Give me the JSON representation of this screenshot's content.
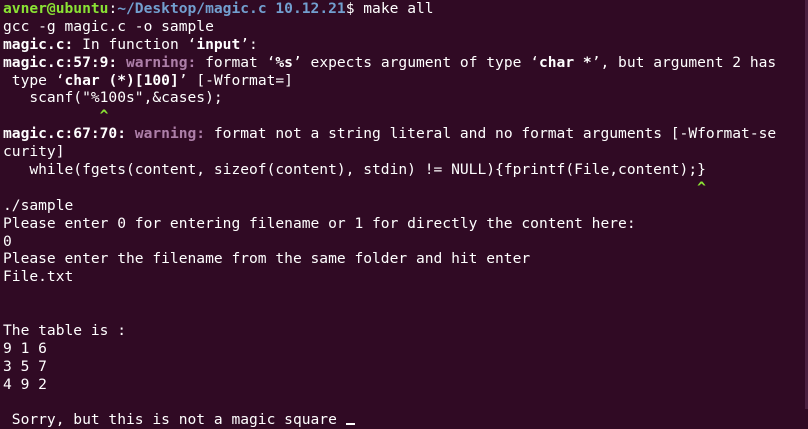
{
  "prompt": {
    "user": "avner@ubuntu",
    "sep": ":",
    "path": "~/Desktop/magic.c 10.12.21",
    "symbol": "$ ",
    "command": "make all"
  },
  "lines": {
    "l2": "gcc -g magic.c -o sample",
    "l3_file": "magic.c:",
    "l3_text": " In function ‘",
    "l3_func": "input",
    "l3_end": "’:",
    "l4_loc": "magic.c:57:9:",
    "l4_warn": " warning:",
    "l4_text1": " format ‘",
    "l4_fmt": "%s",
    "l4_text2": "’ expects argument of type ‘",
    "l4_type": "char *",
    "l4_text3": "’, but argument 2 has",
    "l5_text1": " type ‘",
    "l5_type": "char (*)[100]",
    "l5_text2": "’ [-Wformat=]",
    "l6": "   scanf(\"%100s\",&cases);",
    "l7_caret": "           ^",
    "l8_loc": "magic.c:67:70:",
    "l8_warn": " warning:",
    "l8_text": " format not a string literal and no format arguments [-Wformat-se",
    "l9": "curity]",
    "l10": "   while(fgets(content, sizeof(content), stdin) != NULL){fprintf(File,content);}",
    "l11_caret": "                                                                               ^",
    "l12": "./sample",
    "l13": "Please enter 0 for entering filename or 1 for directly the content here:",
    "l14": "0",
    "l15": "Please enter the filename from the same folder and hit enter",
    "l16": "File.txt",
    "l17": "",
    "l18": "",
    "l19": "The table is :",
    "l20": "9 1 6",
    "l21": "3 5 7",
    "l22": "4 9 2",
    "l23": "",
    "l24": " Sorry, but this is not a magic square "
  }
}
